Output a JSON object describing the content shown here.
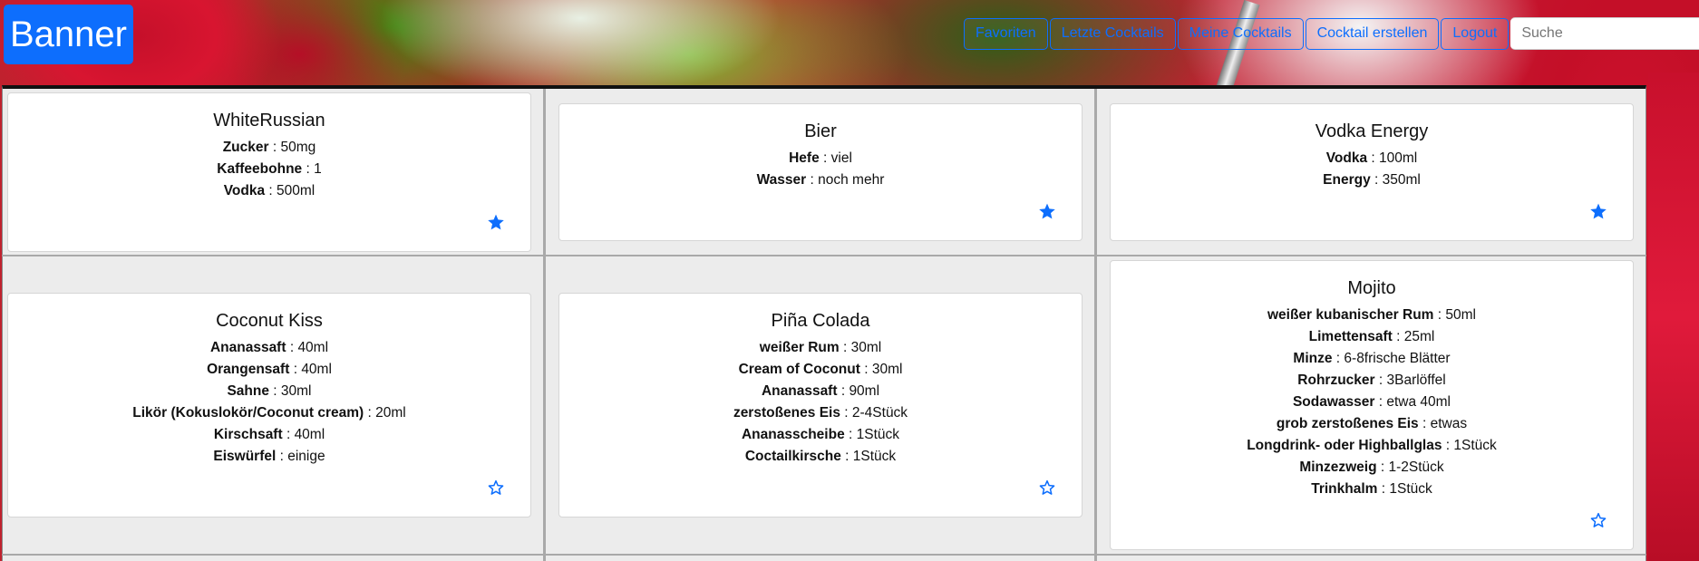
{
  "banner": {
    "label": "Banner"
  },
  "nav": {
    "favorites": "Favoriten",
    "recent": "Letzte Cocktails",
    "mine": "Meine Cocktails",
    "create": "Cocktail erstellen",
    "logout": "Logout",
    "search_placeholder": "Suche"
  },
  "colors": {
    "accent": "#0d6efd"
  },
  "cocktails": [
    {
      "name": "WhiteRussian",
      "favorite": true,
      "ingredients": [
        {
          "name": "Zucker",
          "amount": "50mg"
        },
        {
          "name": "Kaffeebohne",
          "amount": "1"
        },
        {
          "name": "Vodka",
          "amount": "500ml"
        }
      ]
    },
    {
      "name": "Bier",
      "favorite": true,
      "ingredients": [
        {
          "name": "Hefe",
          "amount": "viel"
        },
        {
          "name": "Wasser",
          "amount": "noch mehr"
        }
      ]
    },
    {
      "name": "Vodka Energy",
      "favorite": true,
      "ingredients": [
        {
          "name": "Vodka",
          "amount": "100ml"
        },
        {
          "name": "Energy",
          "amount": "350ml"
        }
      ]
    },
    {
      "name": "Coconut Kiss",
      "favorite": false,
      "ingredients": [
        {
          "name": "Ananassaft",
          "amount": "40ml"
        },
        {
          "name": "Orangensaft",
          "amount": "40ml"
        },
        {
          "name": "Sahne",
          "amount": "30ml"
        },
        {
          "name": "Likör (Kokuslokör/Coconut cream)",
          "amount": "20ml"
        },
        {
          "name": "Kirschsaft",
          "amount": "40ml"
        },
        {
          "name": "Eiswürfel",
          "amount": "einige"
        }
      ]
    },
    {
      "name": "Piña Colada",
      "favorite": false,
      "ingredients": [
        {
          "name": "weißer Rum",
          "amount": "30ml"
        },
        {
          "name": "Cream of Coconut",
          "amount": "30ml"
        },
        {
          "name": "Ananassaft",
          "amount": "90ml"
        },
        {
          "name": "zerstoßenes Eis",
          "amount": "2-4Stück"
        },
        {
          "name": "Ananasscheibe",
          "amount": "1Stück"
        },
        {
          "name": "Coctailkirsche",
          "amount": "1Stück"
        }
      ]
    },
    {
      "name": "Mojito",
      "favorite": false,
      "ingredients": [
        {
          "name": "weißer kubanischer Rum",
          "amount": "50ml"
        },
        {
          "name": "Limettensaft",
          "amount": "25ml"
        },
        {
          "name": "Minze",
          "amount": "6-8frische Blätter"
        },
        {
          "name": "Rohrzucker",
          "amount": "3Barlöffel"
        },
        {
          "name": "Sodawasser",
          "amount": "etwa 40ml"
        },
        {
          "name": "grob zerstoßenes Eis",
          "amount": "etwas"
        },
        {
          "name": "Longdrink- oder Highballglas",
          "amount": "1Stück"
        },
        {
          "name": "Minzezweig",
          "amount": "1-2Stück"
        },
        {
          "name": "Trinkhalm",
          "amount": "1Stück"
        }
      ]
    }
  ]
}
